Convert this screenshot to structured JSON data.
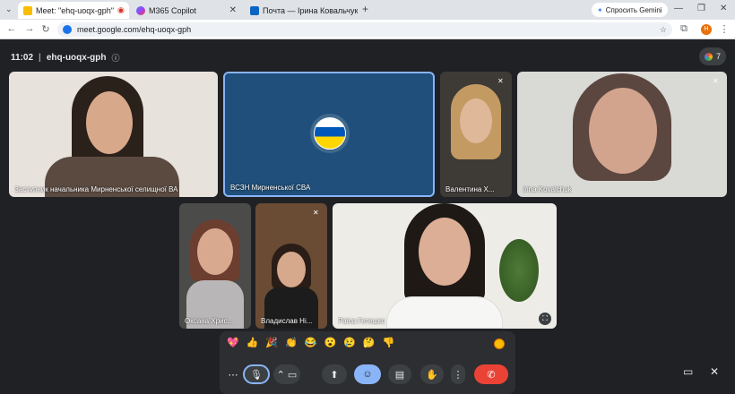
{
  "browser": {
    "tabs": [
      {
        "title": "Meet: \"ehq-uoqx-gph\"",
        "active": true
      },
      {
        "title": "M365 Copilot",
        "active": false
      },
      {
        "title": "Почта — Ірина Ковальчук —",
        "active": false
      }
    ],
    "gemini_button": "Спросить Gemini",
    "url": "meet.google.com/ehq-uoqx-gph",
    "profile_initial": "H"
  },
  "meeting": {
    "time": "11:02",
    "code": "ehq-uoqx-gph",
    "participant_count": "7"
  },
  "tiles": [
    {
      "name": "Заступник начальника Мирненської селищної ВА",
      "muted": false
    },
    {
      "name": "ВСЗН Мирненської СВА",
      "muted": false
    },
    {
      "name": "Валентина Х...",
      "muted": true
    },
    {
      "name": "Irina Kovalchuk",
      "muted": true
    },
    {
      "name": "Оксана Хрис...",
      "muted": false
    },
    {
      "name": "Владислав Ні...",
      "muted": true
    },
    {
      "name": "Раїса Гетешко",
      "muted": false
    }
  ],
  "reactions": [
    "💖",
    "👍",
    "🎉",
    "👏",
    "😂",
    "😮",
    "😢",
    "🤔",
    "👎"
  ],
  "colors": {
    "accent": "#8ab4f8",
    "end_call": "#ea4335",
    "bg": "#202124"
  }
}
